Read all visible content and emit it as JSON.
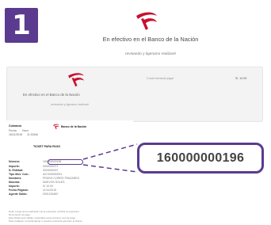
{
  "step": {
    "number": "1"
  },
  "header": {
    "title": "En efectivo en el Banco de la Nación",
    "subtitle": "revisando y ligeramo realizaré"
  },
  "preview": {
    "title": "En efectivo en el Banco de la Nación",
    "subtitle": "revisando y ligeramo realizaré",
    "center_text": "Cuota mensual pagar",
    "right_text": "S/. 10.00"
  },
  "receipt": {
    "bank_name": "Banco de la Nación",
    "top_left": [
      {
        "label": "Cobranza",
        "value": ""
      },
      {
        "label": "Fecha",
        "value": "Hora"
      },
      {
        "label": "16/11/2015",
        "value": "11:15AM"
      }
    ],
    "heading": "TICKET PARA PAGO",
    "rows": [
      {
        "label": "Número:",
        "value": "160000000196"
      },
      {
        "label": "Importe:",
        "value": "0000000071"
      },
      {
        "label": "N. Entidad:",
        "value": "3003000007"
      },
      {
        "label": "Tipo Mov. Cob.:",
        "value": "A/C/000000001"
      },
      {
        "label": "Nombres:",
        "value": "PEDRO CORRO TRAZARES"
      },
      {
        "label": "Moneda:",
        "value": "NUEVOS SOLES"
      },
      {
        "label": "Importe:",
        "value": "S/ 10.00"
      },
      {
        "label": "Fecha Pagado:",
        "value": "11/11/2015"
      },
      {
        "label": "Agente Saldo:",
        "value": "0001234567"
      }
    ],
    "footer": [
      "Nota: Luego de la realización de la operación verificar la operación.",
      "Documento de pago.",
      "Esta boleta será válida y aceptable para el primer mes de pago.",
      "Para cualquier consulta llamar a nuestra central de atención al cliente."
    ]
  },
  "callout": {
    "value": "160000000196"
  },
  "colors": {
    "accent": "#5b3b8f",
    "logo": "#c8102e"
  }
}
